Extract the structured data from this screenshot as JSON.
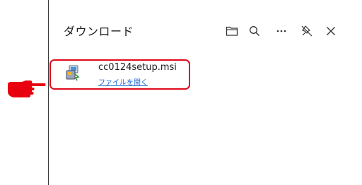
{
  "panel": {
    "title": "ダウンロード"
  },
  "toolbar": {
    "buttons": [
      {
        "icon": "folder-icon"
      },
      {
        "icon": "search-icon"
      },
      {
        "icon": "more-options-icon"
      },
      {
        "icon": "unpin-icon"
      },
      {
        "icon": "close-icon"
      }
    ]
  },
  "downloads": [
    {
      "filename": "cc0124setup.msi",
      "action": "ファイルを開く",
      "icon": "installer-file-icon"
    }
  ],
  "annotation": {
    "highlight_color": "#e0091b",
    "pointer": "pointing-hand-icon"
  }
}
